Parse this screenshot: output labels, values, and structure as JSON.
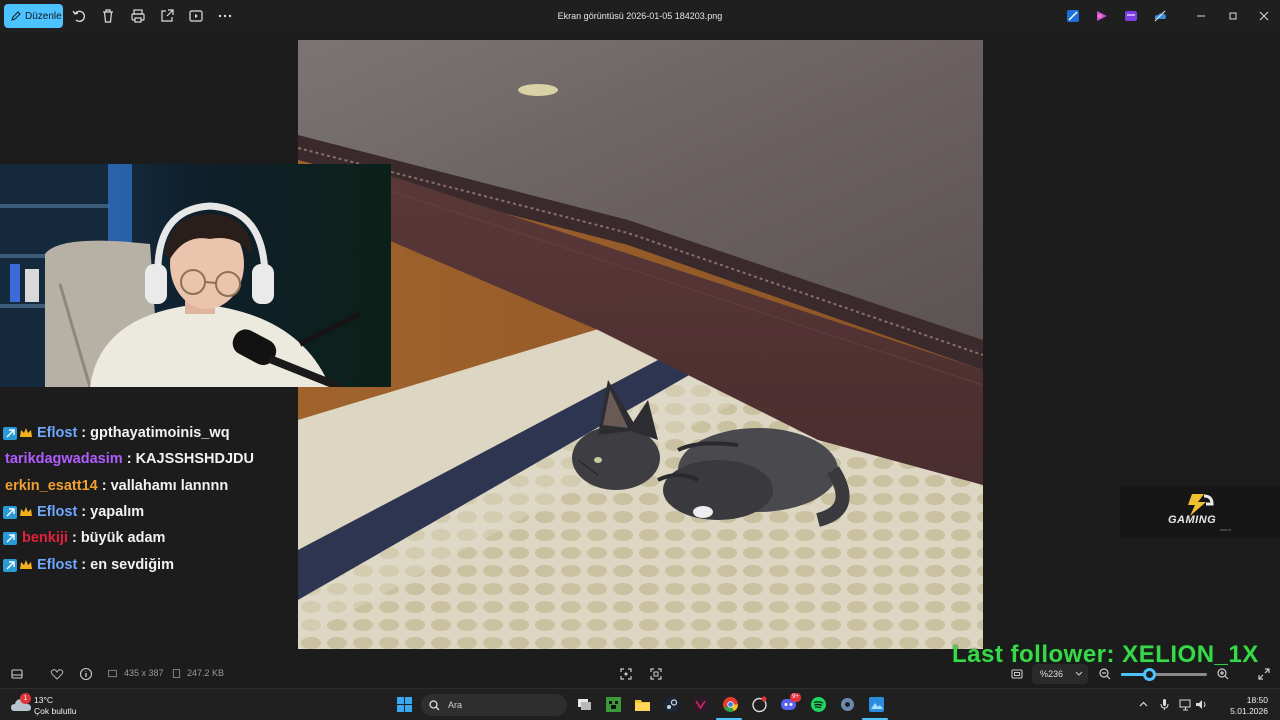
{
  "toolbar": {
    "edit_label": "Düzenle",
    "file_title": "Ekran görüntüsü 2026-01-05 184203.png",
    "icons": [
      "rotate-icon",
      "delete-icon",
      "print-icon",
      "share-icon",
      "slideshow-icon",
      "more-icon"
    ]
  },
  "chat": {
    "messages": [
      {
        "user": "Eflost",
        "text": "gpthayatimoinis_wq",
        "color": "#6fa8ff",
        "badges": [
          "bot-badge",
          "crown-badge"
        ]
      },
      {
        "user": "tarikdagwadasim",
        "text": "KAJSSHSHDJDU",
        "color": "#b05cff",
        "badges": []
      },
      {
        "user": "erkin_esatt14",
        "text": "vallahamı lannnn",
        "color": "#f0a030",
        "badges": []
      },
      {
        "user": "Eflost",
        "text": "yapalım",
        "color": "#6fa8ff",
        "badges": [
          "bot-badge",
          "crown-badge"
        ]
      },
      {
        "user": "benkiji",
        "text": "büyük adam",
        "color": "#e0223c",
        "badges": [
          "bot-badge"
        ]
      },
      {
        "user": "Eflost",
        "text": "en sevdiğim",
        "color": "#6fa8ff",
        "badges": [
          "bot-badge",
          "crown-badge"
        ]
      }
    ]
  },
  "overlay": {
    "follower_text": "Last follower: XELION_1X",
    "gaming_logo_text": "GAMING",
    "gaming_logo_sub": "com.tr"
  },
  "statusbar": {
    "dimensions": "435 x 387",
    "file_size": "247.2 KB",
    "zoom": "%236",
    "zoom_slider_fraction": 0.33
  },
  "taskbar": {
    "weather_temp": "13°C",
    "weather_desc": "Çok bulutlu",
    "weather_badge": "1",
    "search_placeholder": "Ara",
    "time": "18:50",
    "date": "5.01.2026",
    "discord_badge": "9+"
  },
  "colors": {
    "accent": "#4cc2ff",
    "follower_green": "#38d84a"
  }
}
